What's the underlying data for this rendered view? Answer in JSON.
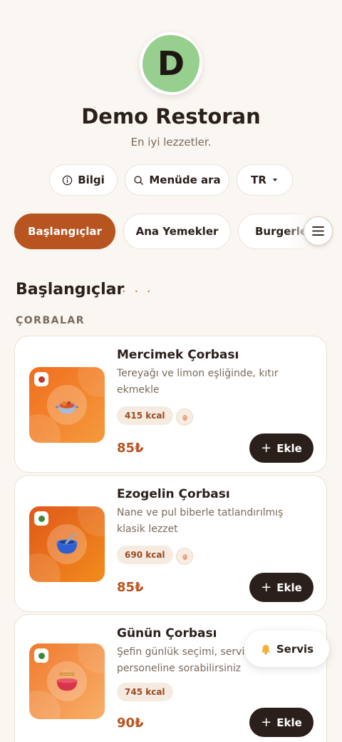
{
  "restaurant": {
    "logo_letter": "D",
    "name": "Demo Restoran",
    "tagline": "En iyi lezzetler."
  },
  "actions": {
    "info_label": "Bilgi",
    "search_label": "Menüde ara",
    "language": "TR"
  },
  "categories": [
    {
      "label": "Başlangıçlar",
      "active": true
    },
    {
      "label": "Ana Yemekler",
      "active": false
    },
    {
      "label": "Burgerler",
      "active": false
    }
  ],
  "section": {
    "title": "Başlangıçlar",
    "dots": "· · ·",
    "subsection": "ÇORBALAR"
  },
  "dishes": [
    {
      "name": "Mercimek Çorbası",
      "description": "Tereyağı ve limon eşliğinde, kıtır ekmekle",
      "kcal": "415 kcal",
      "price": "85₺",
      "add_label": "Ekle",
      "icon": "soup-pot-icon",
      "has_allergen": true
    },
    {
      "name": "Ezogelin Çorbası",
      "description": "Nane ve pul biberle tatlandırılmış klasik lezzet",
      "kcal": "690 kcal",
      "price": "85₺",
      "add_label": "Ekle",
      "icon": "mortar-bowl-icon",
      "has_allergen": true
    },
    {
      "name": "Günün Çorbası",
      "description": "Şefin günlük seçimi, servis personeline sorabilirsiniz",
      "kcal": "745 kcal",
      "price": "90₺",
      "add_label": "Ekle",
      "icon": "noodle-bowl-icon",
      "has_allergen": false
    }
  ],
  "service_button": {
    "label": "Servis",
    "icon": "bell-icon"
  },
  "colors": {
    "accent": "#b8541f",
    "logo_bg": "#96cf8e",
    "dark_button": "#2a1f1a",
    "veg_dot": "#3a8a3a"
  }
}
